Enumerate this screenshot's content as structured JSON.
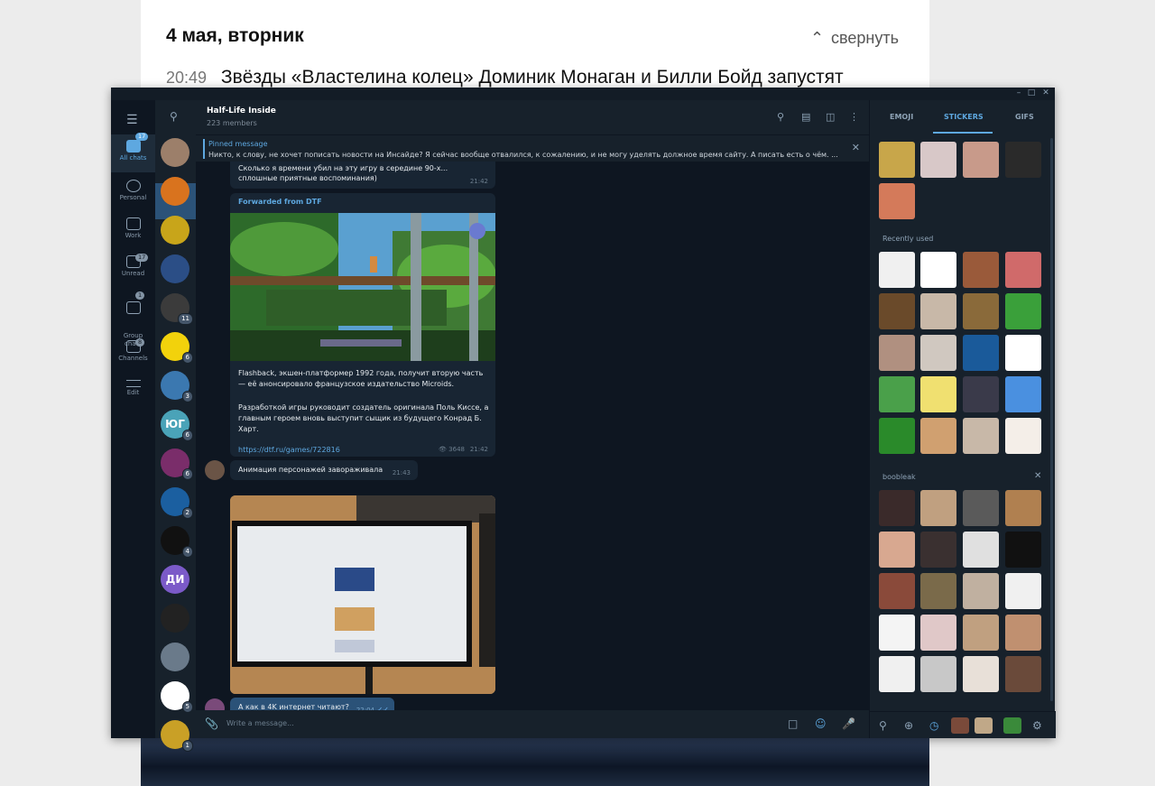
{
  "news": {
    "date": "4 мая, вторник",
    "collapse_label": "свернуть",
    "time": "20:49",
    "headline": "Звёзды «Властелина колец» Доминик Монаган и Билли Бойд запустят"
  },
  "sidebar": {
    "folders": [
      {
        "label": "All chats",
        "badge": "17"
      },
      {
        "label": "Personal",
        "badge": ""
      },
      {
        "label": "Work",
        "badge": ""
      },
      {
        "label": "Unread",
        "badge": "17"
      },
      {
        "label": "Group\nchats",
        "badge": "1"
      },
      {
        "label": "Channels",
        "badge": "8"
      },
      {
        "label": "Edit",
        "badge": ""
      }
    ]
  },
  "chatlist": {
    "avatars": [
      {
        "text": "",
        "count": "",
        "color": "#9c7f6a"
      },
      {
        "text": "",
        "count": "",
        "color": "#d9731e"
      },
      {
        "text": "",
        "count": "",
        "color": "#c8a51a"
      },
      {
        "text": "",
        "count": "",
        "color": "#2b4e86"
      },
      {
        "text": "",
        "count": "11",
        "color": "#3b3b3b"
      },
      {
        "text": "",
        "count": "6",
        "color": "#f2d20c"
      },
      {
        "text": "",
        "count": "3",
        "color": "#3b78b0"
      },
      {
        "text": "ЮГ",
        "count": "6",
        "color": "#4aa3b8"
      },
      {
        "text": "",
        "count": "6",
        "color": "#7a2d6a"
      },
      {
        "text": "",
        "count": "2",
        "color": "#1b5fa0"
      },
      {
        "text": "",
        "count": "4",
        "color": "#111111"
      },
      {
        "text": "ДИ",
        "count": "",
        "color": "#7b5ac8"
      },
      {
        "text": "",
        "count": "",
        "color": "#222222"
      },
      {
        "text": "",
        "count": "",
        "color": "#6a7a8a"
      },
      {
        "text": "",
        "count": "5",
        "color": "#ffffff"
      },
      {
        "text": "",
        "count": "1",
        "color": "#c9a026"
      }
    ]
  },
  "chat": {
    "title": "Half-Life Inside",
    "subtitle": "223 members",
    "pinned_label": "Pinned message",
    "pinned_text": "Никто, к слову, не хочет пописать новости на Инсайде?  Я сейчас вообще отвалился, к сожалению, и не могу уделять должное время сайту. А писать есть о чём. ...",
    "msg1": {
      "text": "Сколько я времени убил на эту игру в середине 90-х... сплошные приятные воспоминания)",
      "time": "21:42"
    },
    "msg2": {
      "forward": "Forwarded from DTF",
      "p1": "Flashback, экшен-платформер 1992 года, получит вторую часть — её анонсировало французское издательство Microids.",
      "p2": "Разработкой игры руководит создатель оригинала Поль Киссе, а главным героем вновь выступит сыщик из будущего Конрад Б. Харт.",
      "link": "https://dtf.ru/games/722816",
      "views": "3648",
      "time": "21:42"
    },
    "msg3": {
      "text": "Анимация персонажей завораживала",
      "time": "21:43"
    },
    "msg4": {
      "text": "А как в 4K интернет читают?",
      "time": "22:04"
    },
    "input_placeholder": "Write a message..."
  },
  "stickers": {
    "tabs": [
      "EMOJI",
      "STICKERS",
      "GIFS"
    ],
    "recent_label": "Recently used",
    "set_label": "boobleak"
  }
}
